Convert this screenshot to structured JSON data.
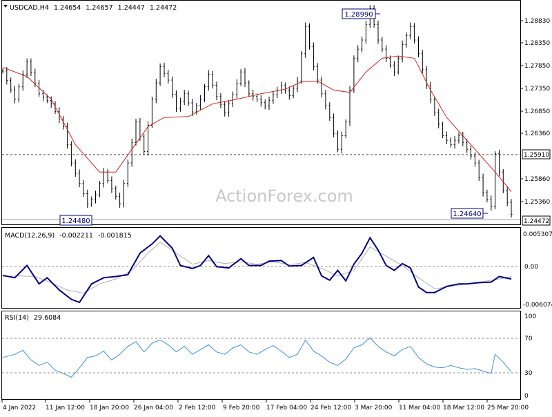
{
  "chart_data": [
    {
      "panel": "price",
      "type": "line",
      "symbol": "USDCAD,H4",
      "ohlc_header": [
        "1.24654",
        "1.24657",
        "1.24447",
        "1.24472"
      ],
      "watermark": "ActionForex.com",
      "ylim": [
        1.2425,
        1.2915
      ],
      "y_ticks": [
        "1.28830",
        "1.28350",
        "1.27850",
        "1.27350",
        "1.26850",
        "1.26360",
        "1.25860",
        "1.25360",
        "1.24860"
      ],
      "x_ticks": [
        "4 Jan 2022",
        "11 Jan 12:00",
        "18 Jan 20:00",
        "26 Jan 04:00",
        "2 Feb 12:00",
        "9 Feb 20:00",
        "17 Feb 04:00",
        "24 Feb 12:00",
        "3 Mar 20:00",
        "11 Mar 04:00",
        "18 Mar 12:00",
        "25 Mar 20:00"
      ],
      "current_price": "1.24472",
      "horizontal_line": "1.25910",
      "annotations": [
        "1.28990",
        "1.24480",
        "1.24640"
      ],
      "price_path": [
        [
          0,
          1.2762
        ],
        [
          3,
          1.27
        ],
        [
          6,
          1.2782
        ],
        [
          9,
          1.2712
        ],
        [
          12,
          1.269
        ],
        [
          15,
          1.264
        ],
        [
          17,
          1.256
        ],
        [
          19,
          1.2515
        ],
        [
          21,
          1.247
        ],
        [
          23,
          1.249
        ],
        [
          25,
          1.254
        ],
        [
          27,
          1.2503
        ],
        [
          29,
          1.247
        ],
        [
          31,
          1.256
        ],
        [
          33,
          1.265
        ],
        [
          35,
          1.2585
        ],
        [
          37,
          1.27
        ],
        [
          39,
          1.2772
        ],
        [
          41,
          1.2742
        ],
        [
          43,
          1.268
        ],
        [
          45,
          1.2712
        ],
        [
          47,
          1.2672
        ],
        [
          49,
          1.27
        ],
        [
          51,
          1.2755
        ],
        [
          53,
          1.2706
        ],
        [
          55,
          1.267
        ],
        [
          57,
          1.271
        ],
        [
          59,
          1.276
        ],
        [
          61,
          1.2712
        ],
        [
          63,
          1.27
        ],
        [
          65,
          1.2685
        ],
        [
          67,
          1.271
        ],
        [
          69,
          1.273
        ],
        [
          71,
          1.2708
        ],
        [
          73,
          1.274
        ],
        [
          75,
          1.286
        ],
        [
          77,
          1.2772
        ],
        [
          79,
          1.2712
        ],
        [
          81,
          1.266
        ],
        [
          83,
          1.259
        ],
        [
          85,
          1.265
        ],
        [
          87,
          1.279
        ],
        [
          89,
          1.283
        ],
        [
          91,
          1.2899
        ],
        [
          93,
          1.283
        ],
        [
          95,
          1.279
        ],
        [
          97,
          1.276
        ],
        [
          99,
          1.282
        ],
        [
          101,
          1.286
        ],
        [
          103,
          1.28
        ],
        [
          105,
          1.273
        ],
        [
          107,
          1.267
        ],
        [
          109,
          1.262
        ],
        [
          111,
          1.26
        ],
        [
          113,
          1.262
        ],
        [
          115,
          1.259
        ],
        [
          117,
          1.256
        ],
        [
          119,
          1.2495
        ],
        [
          121,
          1.2464
        ],
        [
          122,
          1.258
        ],
        [
          124,
          1.25
        ],
        [
          126,
          1.2447
        ]
      ],
      "series": [
        {
          "values": [
            [
              0,
              1.277
            ],
            [
              6,
              1.275
            ],
            [
              12,
              1.27
            ],
            [
              18,
              1.26
            ],
            [
              24,
              1.254
            ],
            [
              28,
              1.254
            ],
            [
              32,
              1.259
            ],
            [
              36,
              1.264
            ],
            [
              40,
              1.266
            ],
            [
              46,
              1.2662
            ],
            [
              52,
              1.269
            ],
            [
              58,
              1.27
            ],
            [
              64,
              1.2712
            ],
            [
              70,
              1.2722
            ],
            [
              74,
              1.2738
            ],
            [
              78,
              1.274
            ],
            [
              82,
              1.272
            ],
            [
              86,
              1.2715
            ],
            [
              90,
              1.276
            ],
            [
              94,
              1.279
            ],
            [
              98,
              1.2795
            ],
            [
              102,
              1.279
            ],
            [
              106,
              1.272
            ],
            [
              110,
              1.266
            ],
            [
              114,
              1.262
            ],
            [
              118,
              1.258
            ],
            [
              122,
              1.254
            ],
            [
              126,
              1.2497
            ]
          ]
        }
      ]
    },
    {
      "panel": "macd",
      "type": "line",
      "label": "MACD(12,26,9)",
      "values_header": [
        "-0.002211",
        "-0.001815"
      ],
      "ylim": [
        -0.0069,
        0.006
      ],
      "y_ticks": [
        "0.005307",
        "0.00",
        "-0.006074"
      ],
      "series": [
        {
          "values": [
            [
              0,
              -0.0016
            ],
            [
              3,
              -0.002
            ],
            [
              6,
              0.0
            ],
            [
              9,
              -0.003
            ],
            [
              11,
              -0.002
            ],
            [
              14,
              -0.004
            ],
            [
              17,
              -0.0055
            ],
            [
              19,
              -0.006
            ],
            [
              22,
              -0.003
            ],
            [
              25,
              -0.002
            ],
            [
              28,
              -0.0018
            ],
            [
              31,
              -0.0015
            ],
            [
              34,
              0.002
            ],
            [
              37,
              0.0035
            ],
            [
              39,
              0.0048
            ],
            [
              42,
              0.0028
            ],
            [
              44,
              0.0
            ],
            [
              47,
              -0.0005
            ],
            [
              49,
              0.0
            ],
            [
              51,
              0.0016
            ],
            [
              53,
              -0.0002
            ],
            [
              56,
              -0.0004
            ],
            [
              59,
              0.0011
            ],
            [
              61,
              0.0
            ],
            [
              64,
              0.0
            ],
            [
              66,
              0.0007
            ],
            [
              69,
              0.0008
            ],
            [
              71,
              -0.0001
            ],
            [
              74,
              0.0
            ],
            [
              77,
              0.0013
            ],
            [
              79,
              -0.0017
            ],
            [
              81,
              -0.0024
            ],
            [
              83,
              -0.0008
            ],
            [
              85,
              -0.0025
            ],
            [
              87,
              0.0002
            ],
            [
              89,
              0.002
            ],
            [
              91,
              0.0045
            ],
            [
              93,
              0.0025
            ],
            [
              95,
              0.0
            ],
            [
              97,
              -0.0008
            ],
            [
              99,
              0.0003
            ],
            [
              101,
              -0.0004
            ],
            [
              103,
              -0.0035
            ],
            [
              105,
              -0.0044
            ],
            [
              107,
              -0.0044
            ],
            [
              110,
              -0.0034
            ],
            [
              113,
              -0.003
            ],
            [
              115,
              -0.003
            ],
            [
              118,
              -0.0028
            ],
            [
              121,
              -0.0027
            ],
            [
              123,
              -0.0018
            ],
            [
              126,
              -0.0022
            ]
          ]
        },
        {
          "values": [
            [
              0,
              -0.0018
            ],
            [
              4,
              -0.0017
            ],
            [
              8,
              -0.0018
            ],
            [
              12,
              -0.0028
            ],
            [
              16,
              -0.004
            ],
            [
              20,
              -0.0045
            ],
            [
              24,
              -0.003
            ],
            [
              28,
              -0.0022
            ],
            [
              32,
              -0.0008
            ],
            [
              36,
              0.002
            ],
            [
              39,
              0.0038
            ],
            [
              43,
              0.002
            ],
            [
              47,
              0.0002
            ],
            [
              51,
              0.0008
            ],
            [
              55,
              0.0003
            ],
            [
              59,
              0.0006
            ],
            [
              63,
              0.0002
            ],
            [
              67,
              0.0006
            ],
            [
              71,
              0.0001
            ],
            [
              75,
              0.0005
            ],
            [
              79,
              -0.0005
            ],
            [
              83,
              -0.0017
            ],
            [
              87,
              -0.0008
            ],
            [
              91,
              0.003
            ],
            [
              95,
              0.0015
            ],
            [
              99,
              0.0
            ],
            [
              103,
              -0.002
            ],
            [
              107,
              -0.0038
            ],
            [
              111,
              -0.0034
            ],
            [
              115,
              -0.003
            ],
            [
              119,
              -0.0026
            ],
            [
              123,
              -0.0022
            ],
            [
              126,
              -0.0018
            ]
          ]
        }
      ]
    },
    {
      "panel": "rsi",
      "type": "line",
      "label": "RSI(14)",
      "current_value": "29.6084",
      "ylim": [
        0,
        100
      ],
      "y_ticks": [
        "100",
        "70",
        "30",
        "0"
      ],
      "levels": [
        70,
        30
      ],
      "series": [
        {
          "values": [
            [
              0,
              48
            ],
            [
              3,
              52
            ],
            [
              5,
              57
            ],
            [
              7,
              45
            ],
            [
              9,
              38
            ],
            [
              11,
              42
            ],
            [
              13,
              32
            ],
            [
              15,
              28
            ],
            [
              17,
              23
            ],
            [
              19,
              35
            ],
            [
              21,
              48
            ],
            [
              23,
              50
            ],
            [
              25,
              56
            ],
            [
              27,
              45
            ],
            [
              29,
              52
            ],
            [
              31,
              62
            ],
            [
              33,
              68
            ],
            [
              35,
              55
            ],
            [
              37,
              66
            ],
            [
              39,
              70
            ],
            [
              41,
              64
            ],
            [
              43,
              55
            ],
            [
              45,
              62
            ],
            [
              47,
              52
            ],
            [
              49,
              58
            ],
            [
              51,
              64
            ],
            [
              53,
              55
            ],
            [
              55,
              52
            ],
            [
              57,
              60
            ],
            [
              59,
              64
            ],
            [
              61,
              55
            ],
            [
              63,
              52
            ],
            [
              65,
              58
            ],
            [
              67,
              63
            ],
            [
              69,
              56
            ],
            [
              71,
              48
            ],
            [
              73,
              52
            ],
            [
              75,
              70
            ],
            [
              77,
              56
            ],
            [
              79,
              50
            ],
            [
              81,
              42
            ],
            [
              83,
              38
            ],
            [
              85,
              46
            ],
            [
              87,
              60
            ],
            [
              89,
              64
            ],
            [
              91,
              73
            ],
            [
              93,
              62
            ],
            [
              95,
              55
            ],
            [
              97,
              50
            ],
            [
              99,
              58
            ],
            [
              101,
              62
            ],
            [
              103,
              48
            ],
            [
              105,
              40
            ],
            [
              107,
              36
            ],
            [
              109,
              35
            ],
            [
              111,
              38
            ],
            [
              113,
              35
            ],
            [
              115,
              33
            ],
            [
              117,
              34
            ],
            [
              119,
              31
            ],
            [
              121,
              28
            ],
            [
              122,
              52
            ],
            [
              124,
              42
            ],
            [
              126,
              30
            ]
          ]
        }
      ]
    }
  ],
  "colors": {
    "price_line": "#000000",
    "moving_average": "#d42020",
    "macd_line": "#000080",
    "macd_signal": "#b0b0b0",
    "rsi_line": "#3a8fd8",
    "watermark": "#c8c8c8"
  }
}
